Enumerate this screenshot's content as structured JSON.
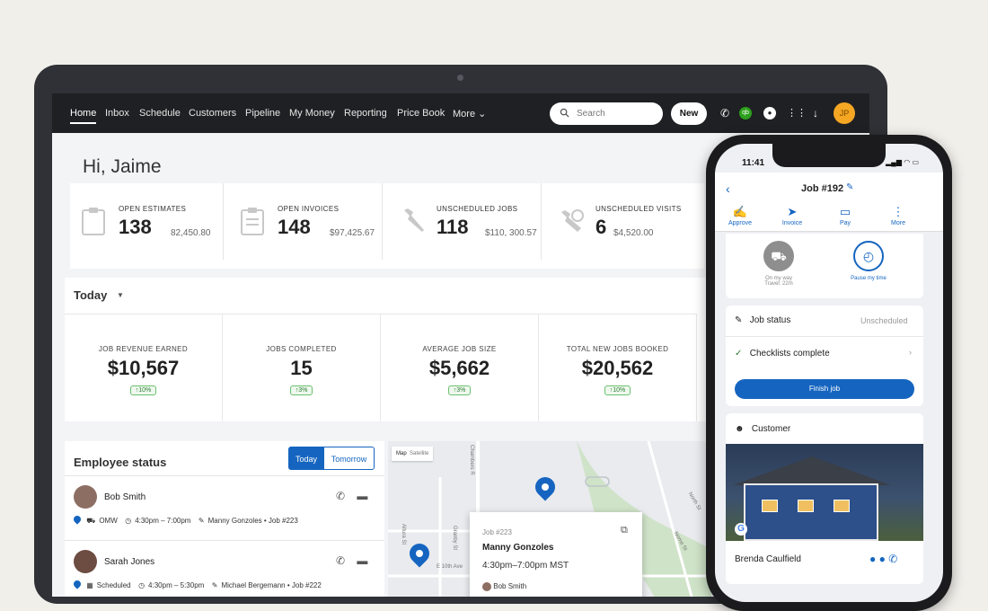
{
  "nav": {
    "items": [
      "Home",
      "Inbox",
      "Schedule",
      "Customers",
      "Pipeline",
      "My Money",
      "Reporting",
      "Price Book",
      "More"
    ],
    "search_placeholder": "Search",
    "new_label": "New",
    "avatar_initials": "JP",
    "icons": [
      "phone-icon",
      "quickbooks-icon",
      "location-icon",
      "apps-grid-icon",
      "download-icon"
    ]
  },
  "greeting": "Hi, Jaime",
  "stats": [
    {
      "label": "OPEN ESTIMATES",
      "count": "138",
      "amount": "82,450.80",
      "icon": "clipboard-icon"
    },
    {
      "label": "OPEN INVOICES",
      "count": "148",
      "amount": "$97,425.67",
      "icon": "invoice-icon"
    },
    {
      "label": "UNSCHEDULED JOBS",
      "count": "118",
      "amount": "$110, 300.57",
      "icon": "wrench-icon"
    },
    {
      "label": "UNSCHEDULED VISITS",
      "count": "6",
      "amount": "$4,520.00",
      "icon": "visit-icon"
    }
  ],
  "today": {
    "label": "Today",
    "kpis": [
      {
        "label": "JOB REVENUE EARNED",
        "value": "$10,567",
        "change": "↑10%"
      },
      {
        "label": "JOBS COMPLETED",
        "value": "15",
        "change": "↑3%"
      },
      {
        "label": "AVERAGE JOB SIZE",
        "value": "$5,662",
        "change": "↑3%"
      },
      {
        "label": "TOTAL NEW JOBS BOOKED",
        "value": "$20,562",
        "change": "↑10%"
      }
    ]
  },
  "employee_status": {
    "title": "Employee status",
    "tabs": [
      "Today",
      "Tomorrow"
    ],
    "rows": [
      {
        "name": "Bob Smith",
        "status": "OMW",
        "time": "4:30pm – 7:00pm",
        "job": "Manny Gonzoles • Job #223"
      },
      {
        "name": "Sarah Jones",
        "status": "Scheduled",
        "time": "4:30pm – 5:30pm",
        "job": "Michael Bergemann • Job #222"
      }
    ]
  },
  "map": {
    "tabs": [
      "Map",
      "Satellite"
    ],
    "streets": [
      "Chambers R",
      "Altura St",
      "Granby St",
      "E 10th Ave",
      "North St",
      "Nome St"
    ],
    "popup": {
      "job": "Job #223",
      "name": "Manny Gonzoles",
      "time": "4:30pm–7:00pm MST",
      "tech": "Bob Smith"
    }
  },
  "phone": {
    "time": "11:41",
    "title": "Job #192",
    "actions": [
      "Approve",
      "Invoice",
      "Pay",
      "More"
    ],
    "on_my_way": "On my way",
    "travel": "Travel: 22m",
    "pause": "Pause my time",
    "job_status_label": "Job status",
    "job_status_value": "Unscheduled",
    "checklists": "Checklists complete",
    "finish": "Finish job",
    "customer_label": "Customer",
    "customer_name": "Brenda Caulfield"
  }
}
